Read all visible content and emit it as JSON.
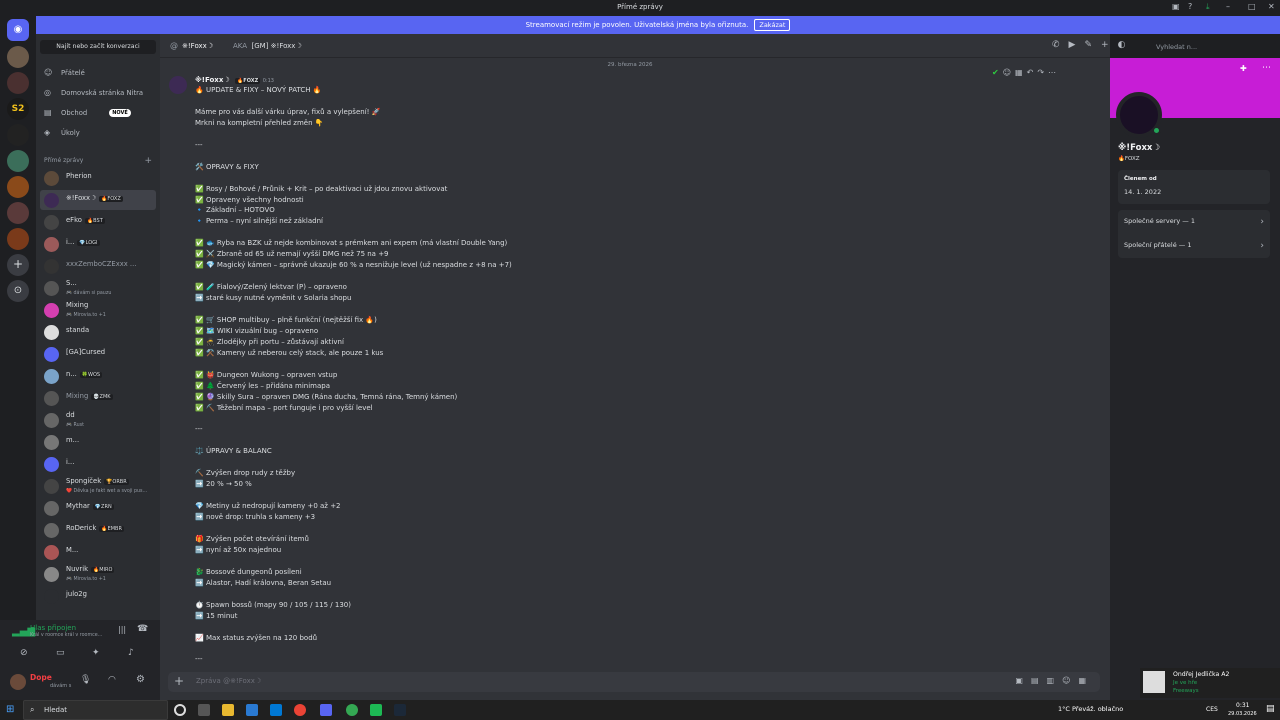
{
  "window": {
    "title": "Přímé zprávy"
  },
  "banner": {
    "text": "Streamovací režim je povolen. Uživatelská jména byla ořiznuta.",
    "button": "Zakázat"
  },
  "sidebar": {
    "find": "Najít nebo začít konverzaci",
    "nav": [
      {
        "label": "Přátelé",
        "icon": "friends-icon"
      },
      {
        "label": "Domovská stránka Nitra",
        "icon": "nitro-icon"
      },
      {
        "label": "Obchod",
        "icon": "shop-icon",
        "badge": "NOVÉ"
      },
      {
        "label": "Úkoly",
        "icon": "quests-icon"
      }
    ],
    "dm_header": "Přímé zprávy",
    "dms": [
      {
        "name": "Pherion",
        "color": "#5c4a3a"
      },
      {
        "name": "※!Foxx☽",
        "tag": "🔥FOXZ",
        "color": "#3d2a54",
        "selected": true
      },
      {
        "name": "eFko",
        "tag": "🔥BST",
        "color": "#444"
      },
      {
        "name": "i...",
        "tag": "💎LOGI",
        "color": "#9b5a5a"
      },
      {
        "name": "xxxZemboCZExxx ...",
        "color": "#333",
        "dim": true
      },
      {
        "name": "S...",
        "sub": "🎮 dávám si pauzu",
        "color": "#555"
      },
      {
        "name": "Mixing",
        "sub": "🎮 Mirovia.to +1",
        "color": "#d43fb0"
      },
      {
        "name": "standa",
        "color": "#ddd"
      },
      {
        "name": "[GA]Cursed",
        "color": "#5865f2"
      },
      {
        "name": "n...",
        "tag": "🍀WOS",
        "color": "#7aa3c9"
      },
      {
        "name": "Mixing",
        "tag": "💀ZMK",
        "color": "#555",
        "dim": true
      },
      {
        "name": "dd",
        "sub": "🎮 Rust",
        "color": "#666"
      },
      {
        "name": "m...",
        "color": "#777"
      },
      {
        "name": "i...",
        "color": "#5865f2"
      },
      {
        "name": "Spongíček",
        "tag": "🏆ORBR",
        "sub": "❤️ Děvka je fakt wet a svoji pus...",
        "color": "#444"
      },
      {
        "name": "Mythar",
        "tag": "💎ZRN",
        "color": "#666"
      },
      {
        "name": "RoDerick",
        "tag": "🔥EMBR",
        "color": "#666"
      },
      {
        "name": "M...",
        "color": "#aa5555"
      },
      {
        "name": "Nuvrik",
        "tag": "🔥MIRO",
        "sub": "🎮 Mirovia.to +1",
        "color": "#888"
      },
      {
        "name": "julo2g",
        "color": "#2b2d31"
      }
    ],
    "voice": {
      "status": "Hlas připojen",
      "channel": "Král v roomce král v roomce..."
    },
    "user": {
      "name": "Dope",
      "status": "dávám s"
    }
  },
  "header": {
    "name": "※!Foxx☽",
    "aka_label": "AKA",
    "aka": "[GM] ※!Foxx☽"
  },
  "search": {
    "placeholder": "Vyhledat n..."
  },
  "chat": {
    "date": "29. března 2026",
    "author": "※!Foxx☽",
    "author_tag": "🔥FOXZ",
    "time": "0:13",
    "lines": [
      "🔥 UPDATE & FIXY – NOVÝ PATCH 🔥",
      "",
      "Máme pro vás další várku úprav, fixů a vylepšení! 🚀",
      "Mrkni na kompletní přehled změn 👇",
      "",
      "---",
      "",
      "🛠️ OPRAVY & FIXY",
      "",
      "✅ Rosy / Bohové / Průnik + Krit – po deaktivaci už jdou znovu aktivovat",
      "✅ Opraveny všechny hodnosti",
      "      🔹 Základní – HOTOVO",
      "      🔹 Perma – nyní silnější než základní",
      "",
      "✅ 🐟 Ryba na BZK už nejde kombinovat s prémkem ani expem (má vlastní Double Yang)",
      "✅ ⚔️ Zbraně od 65 už nemají vyšší DMG než 75 na +9",
      "✅ 💎 Magický kámen – správně ukazuje 60 % a nesnižuje level (už nespadne z +8 na +7)",
      "",
      "✅ 🧪 Fialový/Zelený lektvar (P) – opraveno",
      "      ➡️ staré kusy nutné vyměnit v Solaria shopu",
      "",
      "✅ 🛒 SHOP multibuy – plně funkční (nejtěžší fix 🔥)",
      "✅ 🗺️ WIKI vizuální bug – opraveno",
      "✅ 🥷 Zlodějky při portu – zůstávají aktivní",
      "✅ ⚒️ Kameny už neberou celý stack, ale pouze 1 kus",
      "",
      "✅ 👹 Dungeon Wukong – opraven vstup",
      "✅ 🌲 Červený les – přidána minimapa",
      "✅ 🔮 Skilly Sura – opraven DMG (Rána ducha, Temná rána, Temný kámen)",
      "✅ ⛏️ Těžební mapa – port funguje i pro vyšší level",
      "",
      "---",
      "",
      "⚖️ ÚPRAVY & BALANC",
      "",
      "⛏️ Zvýšen drop rudy z těžby",
      "      ➡️ 20 % → 50 %",
      "",
      "💎 Metiny už nedropují kameny +0 až +2",
      "      ➡️ nově drop: truhla s kameny +3",
      "",
      "🎁 Zvýšen počet otevírání itemů",
      "      ➡️ nyní až 50x najednou",
      "",
      "🐉 Bossové dungeonů posíleni",
      "      ➡️ Alastor, Hadí královna, Beran Setau",
      "",
      "⏱️ Spawn bossů (mapy 90 / 105 / 115 / 130)",
      "      ➡️ 15 minut",
      "",
      "📈 Max status zvýšen na 120 bodů",
      "",
      "---"
    ]
  },
  "composer": {
    "placeholder": "Zpráva @※!Foxx☽"
  },
  "profile": {
    "name": "※!Foxx☽",
    "tag": "🔥FOXZ",
    "member_label": "Členem od",
    "member_date": "14. 1. 2022",
    "servers": "Společné servery — 1",
    "friends": "Společní přátelé — 1"
  },
  "notification": {
    "title": "Ondřej Jedlička A2",
    "line1": "Je ve hře",
    "line2": "Freeways"
  },
  "taskbar": {
    "search": "Hledat",
    "weather": "1°C  Převáž. oblačno",
    "lang": "CES",
    "time": "0:31",
    "date": "29.03.2026"
  }
}
